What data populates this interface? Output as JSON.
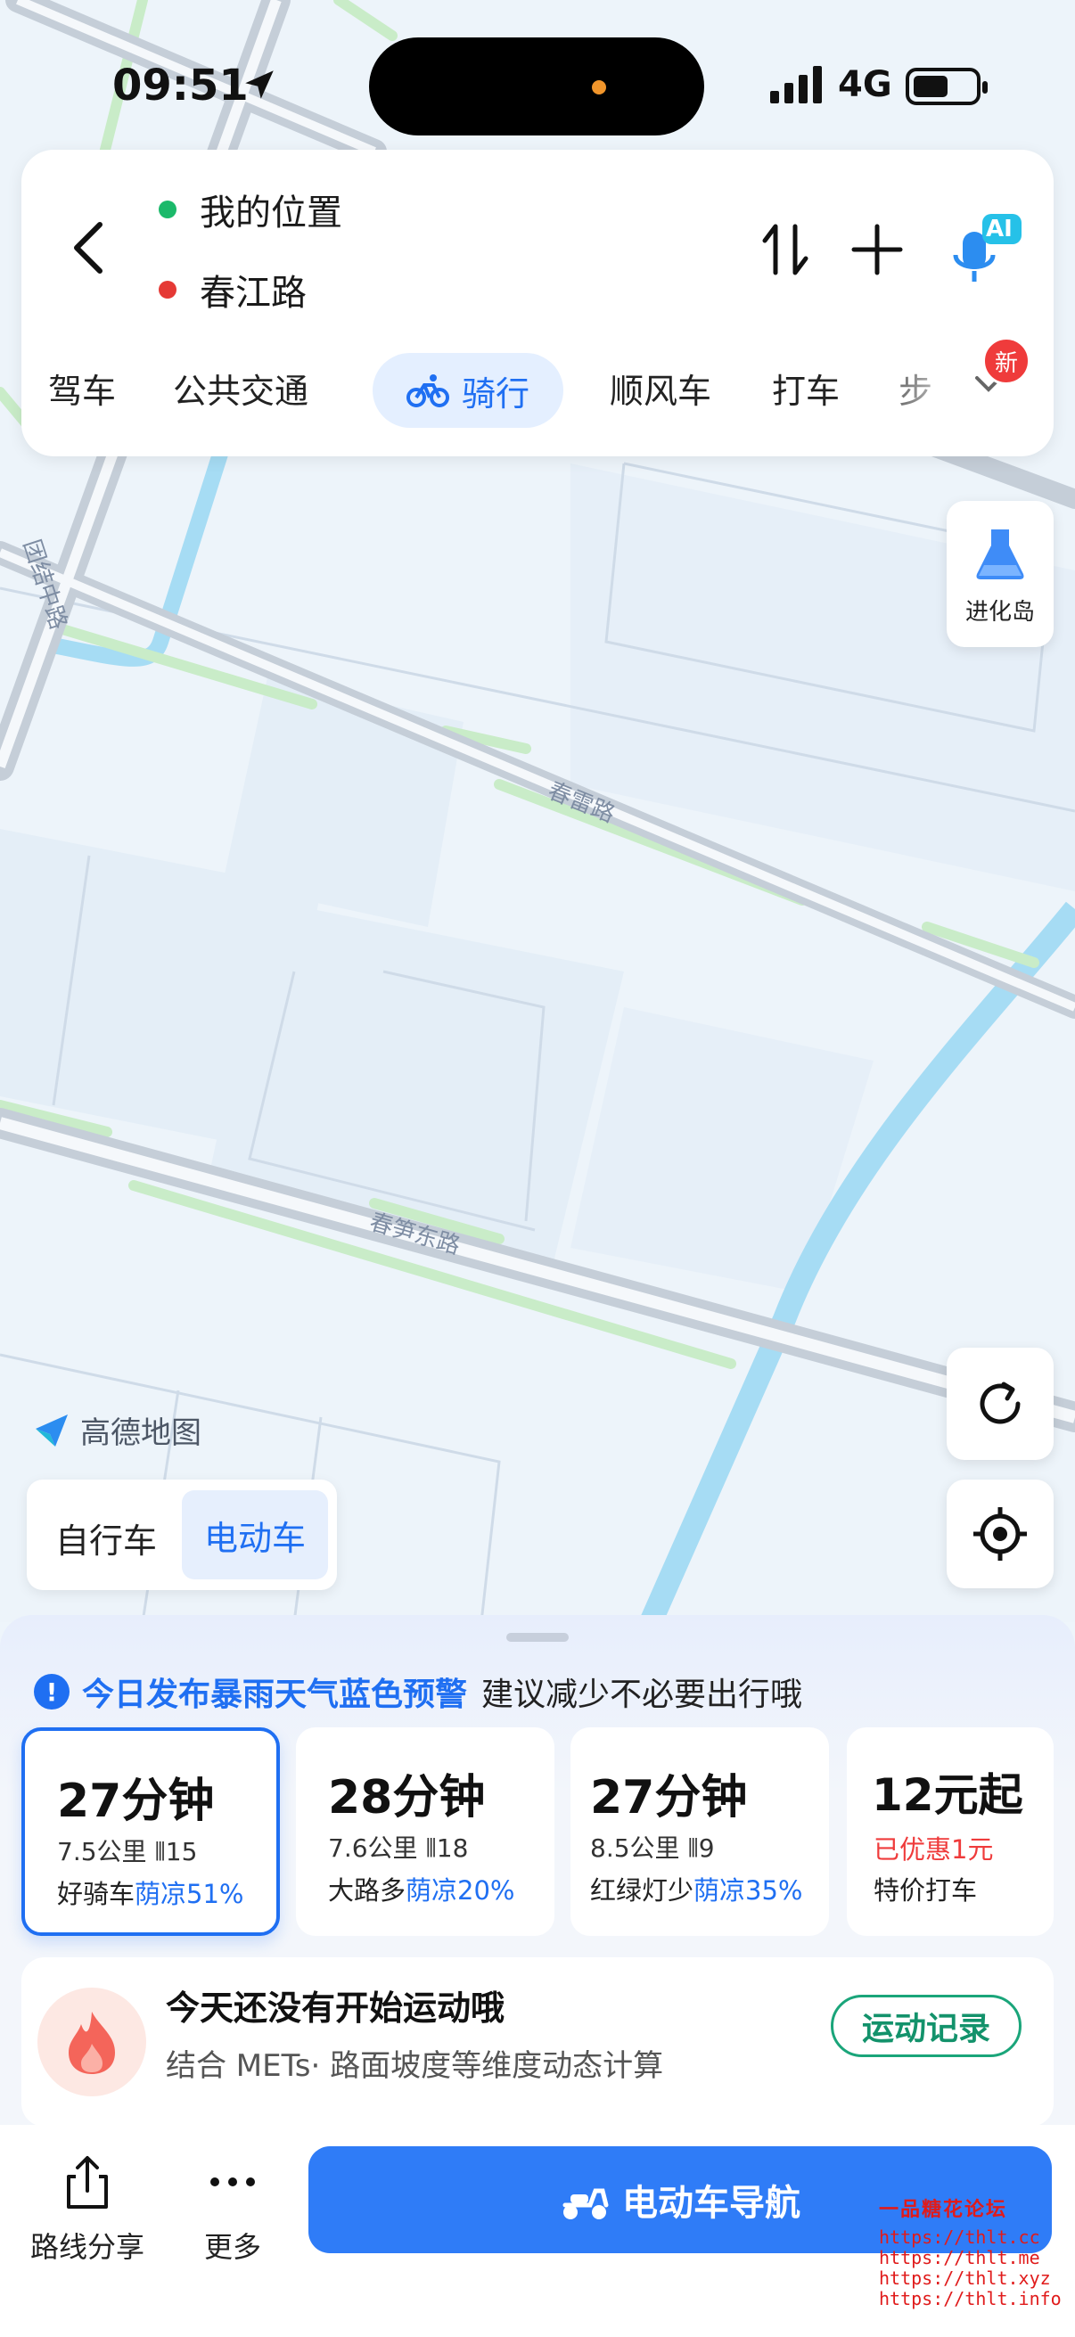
{
  "status_bar": {
    "time": "09:51",
    "network": "4G"
  },
  "route": {
    "start": "我的位置",
    "end": "春江路",
    "ai_badge": "AI",
    "start_color": "#1bb96a",
    "end_color": "#e53935"
  },
  "modes": {
    "items": [
      "驾车",
      "公共交通",
      "骑行",
      "顺风车",
      "打车",
      "步"
    ],
    "active": "骑行",
    "new_badge": "新"
  },
  "map": {
    "roads": [
      "团结中路",
      "春雷路",
      "春笋东路"
    ],
    "evolution_label": "进化岛",
    "logo": "高德地图"
  },
  "vehicle": {
    "options": [
      "自行车",
      "电动车"
    ],
    "selected": "电动车"
  },
  "alert": {
    "title": "今日发布暴雨天气蓝色预警",
    "message": "建议减少不必要出行哦"
  },
  "route_options": [
    {
      "time": "27分钟",
      "distance": "7.5公里",
      "lights": "15",
      "tag": "好骑车",
      "cool": "荫凉51%",
      "selected": true
    },
    {
      "time": "28分钟",
      "distance": "7.6公里",
      "lights": "18",
      "tag": "大路多",
      "cool": "荫凉20%",
      "selected": false
    },
    {
      "time": "27分钟",
      "distance": "8.5公里",
      "lights": "9",
      "tag": "红绿灯少",
      "cool": "荫凉35%",
      "selected": false
    },
    {
      "time": "12元起",
      "discount": "已优惠1元",
      "sub": "特价打车"
    }
  ],
  "exercise": {
    "title": "今天还没有开始运动哦",
    "subtitle": "结合 METs· 路面坡度等维度动态计算",
    "button": "运动记录"
  },
  "bottom": {
    "share": "路线分享",
    "more": "更多",
    "navigate": "电动车导航"
  },
  "watermark": [
    "一品糖花论坛",
    "https://thlt.cc",
    "https://thlt.me",
    "https://thlt.xyz",
    "https://thlt.info"
  ],
  "colors": {
    "accent": "#1f6ff2",
    "nav_button": "#2f7cf7",
    "exercise_green": "#13926b",
    "alert_red": "#ef3b3b"
  }
}
